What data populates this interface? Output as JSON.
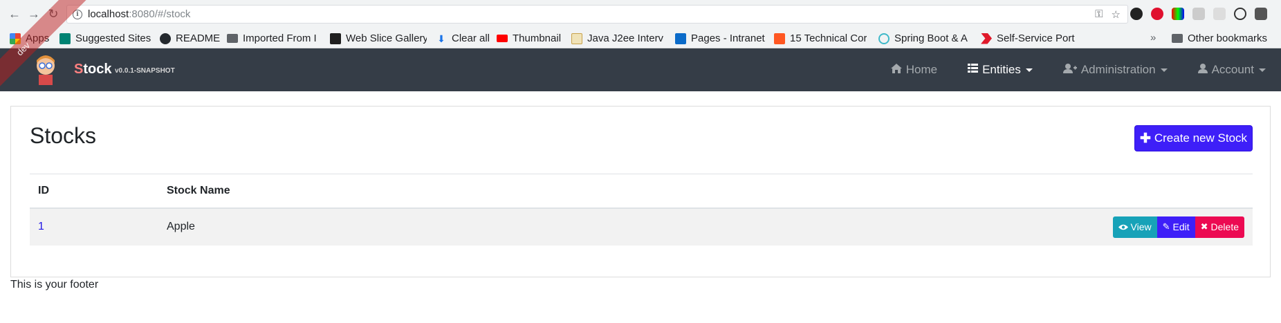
{
  "browser": {
    "url_host": "localhost",
    "url_rest": ":8080/#/stock",
    "bookmarks": [
      {
        "label": "Apps",
        "icon": "apps-grid-icon",
        "color": "#4285f4"
      },
      {
        "label": "Suggested Sites",
        "icon": "bing-icon",
        "color": "#008373"
      },
      {
        "label": "README",
        "icon": "github-icon",
        "color": "#24292e"
      },
      {
        "label": "Imported From I",
        "icon": "folder-icon",
        "color": "#5f6368"
      },
      {
        "label": "Web Slice Gallery",
        "icon": "web-slice-icon",
        "color": "#1f1f1f"
      },
      {
        "label": "Clear all",
        "icon": "download-icon",
        "color": "#1a73e8"
      },
      {
        "label": "Thumbnail",
        "icon": "youtube-icon",
        "color": "#ff0000"
      },
      {
        "label": "Java J2ee Interv",
        "icon": "page-icon",
        "color": "#c8a24a"
      },
      {
        "label": "Pages - Intranet",
        "icon": "sharepoint-icon",
        "color": "#0b6bc9"
      },
      {
        "label": "15 Technical Cor",
        "icon": "blogger-icon",
        "color": "#ff5722"
      },
      {
        "label": "Spring Boot & A",
        "icon": "spring-icon",
        "color": "#3fb9c9"
      },
      {
        "label": "Self-Service Port",
        "icon": "arrow-logo-icon",
        "color": "#e01a2b"
      }
    ],
    "other_bookmarks": "Other bookmarks"
  },
  "navbar": {
    "brand_first": "S",
    "brand_rest": "tock",
    "version": "v0.0.1-SNAPSHOT",
    "ribbon": "dev",
    "items": [
      {
        "label": "Home",
        "icon": "home-icon",
        "active": false,
        "dropdown": false
      },
      {
        "label": "Entities",
        "icon": "list-icon",
        "active": true,
        "dropdown": true
      },
      {
        "label": "Administration",
        "icon": "user-plus-icon",
        "active": false,
        "dropdown": true
      },
      {
        "label": "Account",
        "icon": "user-icon",
        "active": false,
        "dropdown": true
      }
    ]
  },
  "page": {
    "title": "Stocks",
    "create_button": "Create new Stock",
    "columns": [
      "ID",
      "Stock Name"
    ],
    "rows": [
      {
        "id": "1",
        "name": "Apple"
      }
    ],
    "actions": {
      "view": "View",
      "edit": "Edit",
      "delete": "Delete"
    }
  },
  "footer": "This is your footer",
  "colors": {
    "navbar_bg": "#353d47",
    "primary": "#3e1ff8",
    "info": "#17a2b8",
    "danger": "#ec0a52"
  }
}
